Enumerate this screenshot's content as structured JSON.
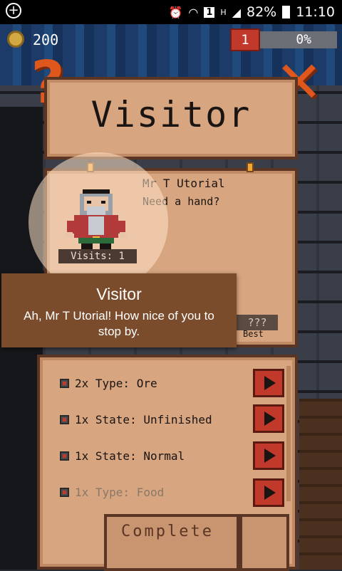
{
  "status_bar": {
    "battery": "82%",
    "time": "11:10",
    "sim_slot": "1",
    "network": "H"
  },
  "hud": {
    "coins": "200",
    "level": "1",
    "progress": "0%"
  },
  "title": "Visitor",
  "visitor": {
    "name": "Mr T Utorial",
    "greeting": "Need a hand?",
    "visits": "Visits: 1",
    "best_value": "???",
    "best_label": "Best"
  },
  "tooltip": {
    "title": "Visitor",
    "body": "Ah, Mr T Utorial! How nice of you to stop by."
  },
  "tasks": [
    {
      "label": "2x Type: Ore",
      "dim": false
    },
    {
      "label": "1x State: Unfinished",
      "dim": false
    },
    {
      "label": "1x State: Normal",
      "dim": false
    },
    {
      "label": "1x Type: Food",
      "dim": true
    }
  ],
  "footer": {
    "complete_label": "Complete"
  },
  "colors": {
    "accent_red": "#c0392b",
    "panel": "#d7a57f",
    "tooltip": "#7a4c2c"
  }
}
